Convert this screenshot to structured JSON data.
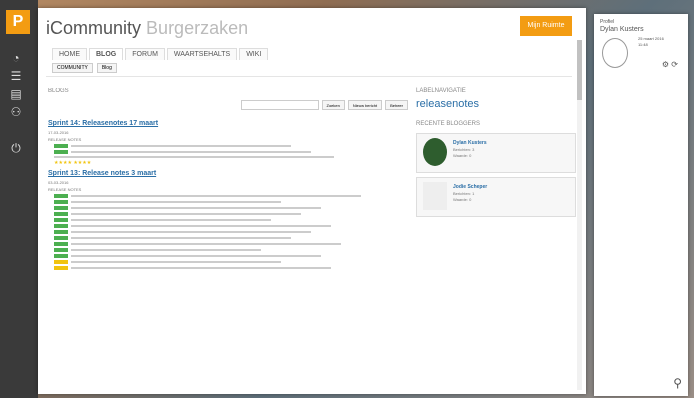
{
  "app": {
    "title": "iCommunity",
    "subtitle": "Burgerzaken",
    "my_space": "Mijn Ruimte",
    "logo_letter": "P"
  },
  "tabs": [
    "HOME",
    "BLOG",
    "FORUM",
    "WAARTSEHALTS",
    "WIKI"
  ],
  "subnav": [
    "COMMUNITY",
    "Blog"
  ],
  "blogs": {
    "section_label": "BLOGS",
    "search_placeholder": "",
    "buttons": [
      "Zoeken",
      "Nieuw bericht",
      "Beheer"
    ],
    "posts": [
      {
        "title": "Sprint 14: Releasenotes 17 maart",
        "date": "17-03-2016",
        "category": "RELEASE NOTES"
      },
      {
        "title": "Sprint 13: Release notes 3 maart",
        "date": "03-03-2016",
        "category": "RELEASE NOTES"
      }
    ]
  },
  "sidebar": {
    "labels_heading": "LABELNAVIGATIE",
    "cloud_big": "releasenotes",
    "recent_heading": "RECENTE BLOGGERS",
    "bloggers": [
      {
        "name": "Dylan Kusters",
        "meta1": "Berichten: 3",
        "meta2": "Waarde: 0"
      },
      {
        "name": "Jodie Scheper",
        "meta1": "Berichten: 1",
        "meta2": "Waarde: 0"
      }
    ]
  },
  "profile": {
    "heading": "Profiel",
    "name": "Dylan Kusters",
    "date": "25 maart 2016",
    "time": "11:48"
  }
}
